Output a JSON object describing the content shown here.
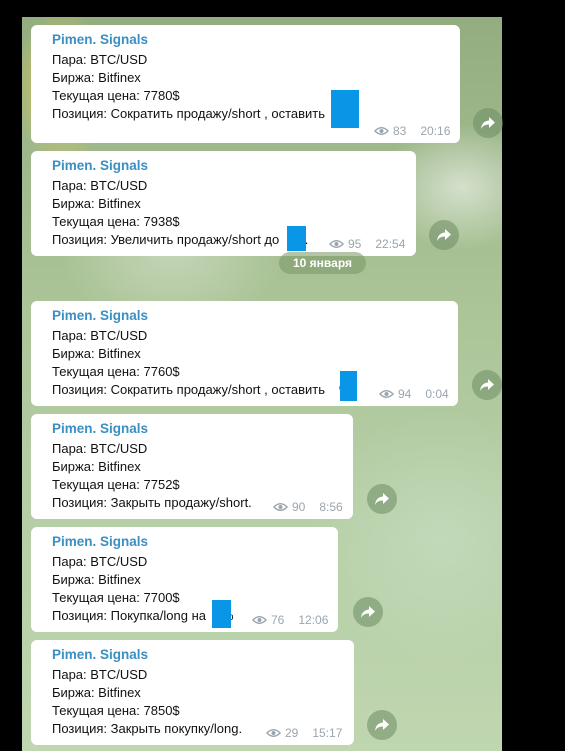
{
  "channel": {
    "sender": "Pimen. Signals"
  },
  "date_divider": "10 января",
  "messages": [
    {
      "pair": "Пара: BTC/USD",
      "exchange": "Биржа: Bitfinex",
      "price": "Текущая цена: 7780$",
      "position": "Позиция:   Сократить продажу/short , оставить",
      "position_suffix": "%",
      "views": "83",
      "time": "20:16"
    },
    {
      "pair": "Пара: BTC/USD",
      "exchange": "Биржа: Bitfinex",
      "price": "Текущая цена: 7938$",
      "position": "Позиция:  Увеличить продажу/short до",
      "position_suffix": "%.",
      "views": "95",
      "time": "22:54"
    },
    {
      "pair": "Пара: BTC/USD",
      "exchange": "Биржа: Bitfinex",
      "price": "Текущая цена: 7760$",
      "position": "Позиция:   Сократить продажу/short , оставить",
      "position_suffix": "%",
      "views": "94",
      "time": "0:04"
    },
    {
      "pair": "Пара: BTC/USD",
      "exchange": "Биржа: Bitfinex",
      "price": "Текущая цена: 7752$",
      "position": "Позиция:   Закрыть продажу/short.",
      "position_suffix": "",
      "views": "90",
      "time": "8:56"
    },
    {
      "pair": "Пара: BTC/USD",
      "exchange": "Биржа: Bitfinex",
      "price": "Текущая цена: 7700$",
      "position": "Позиция:   Покупка/long на",
      "position_suffix": "%",
      "views": "76",
      "time": "12:06"
    },
    {
      "pair": "Пара: BTC/USD",
      "exchange": "Биржа: Bitfinex",
      "price": "Текущая цена: 7850$",
      "position": "Позиция:   Закрыть покупку/long.",
      "position_suffix": "",
      "views": "29",
      "time": "15:17"
    }
  ],
  "icons": {
    "views": "eye-icon",
    "share": "share-arrow-icon"
  },
  "colors": {
    "sender": "#3a8fc3",
    "redaction": "#0a96e6",
    "meta": "#9aa5ae",
    "bubble": "#ffffff"
  }
}
